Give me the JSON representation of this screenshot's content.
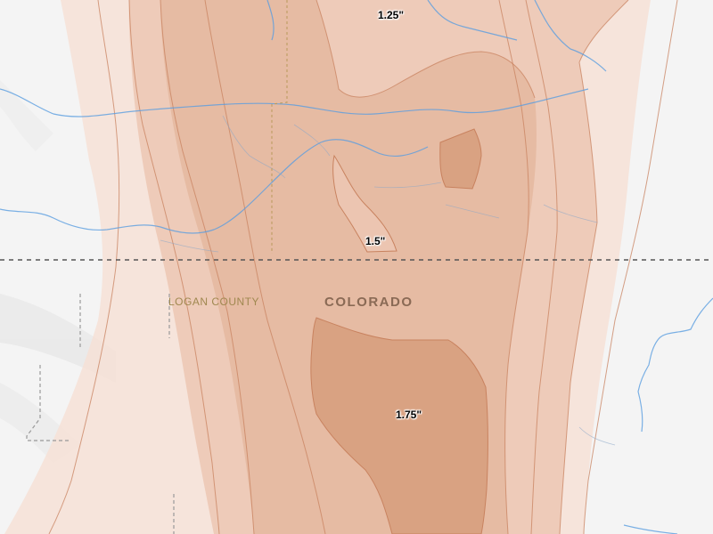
{
  "colors": {
    "background": "#f4f4f4",
    "band_1": "#f6e1d6",
    "band_2": "#ecc7b3",
    "band_3": "#e4b9a1",
    "band_4": "#d8a081",
    "contour_line": "#c8825f",
    "river": "#5a9ee0",
    "state_border": "#555555",
    "county_border": "#aaaaaa",
    "state_label": "#8a6a55",
    "county_label": "#a08850"
  },
  "labels": {
    "state": "COLORADO",
    "county": "LOGAN COUNTY"
  },
  "contours": [
    {
      "value": "1.25\""
    },
    {
      "value": "1.5\""
    },
    {
      "value": "1.75\""
    }
  ]
}
